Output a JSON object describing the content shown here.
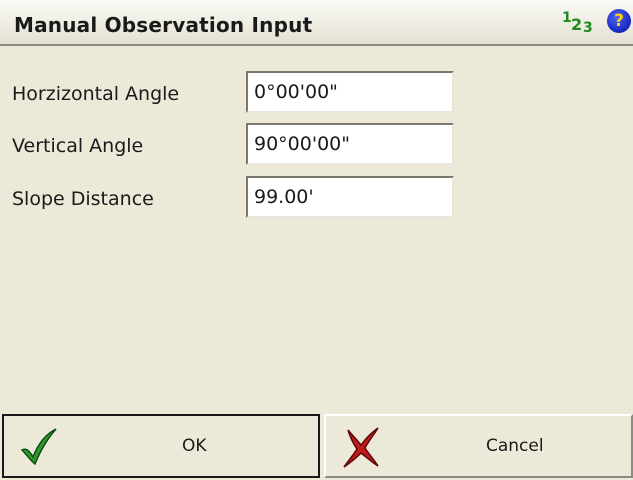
{
  "window": {
    "title": "Manual Observation Input"
  },
  "header": {
    "mode_indicator": {
      "d1": "1",
      "d2": "2",
      "d3": "3"
    },
    "help_icon_glyph": "?"
  },
  "fields": [
    {
      "label": "Horzizontal Angle",
      "value": "0°00'00\""
    },
    {
      "label": "Vertical Angle",
      "value": "90°00'00\""
    },
    {
      "label": "Slope Distance",
      "value": "99.00'"
    }
  ],
  "buttons": {
    "ok_label": "OK",
    "cancel_label": "Cancel"
  },
  "colors": {
    "background": "#ECE9D8",
    "ok_check": "#2E9A2E",
    "cancel_x": "#C21A1A",
    "help_icon": "#1C2FC8",
    "mode_icon": "#1C8A1C"
  }
}
